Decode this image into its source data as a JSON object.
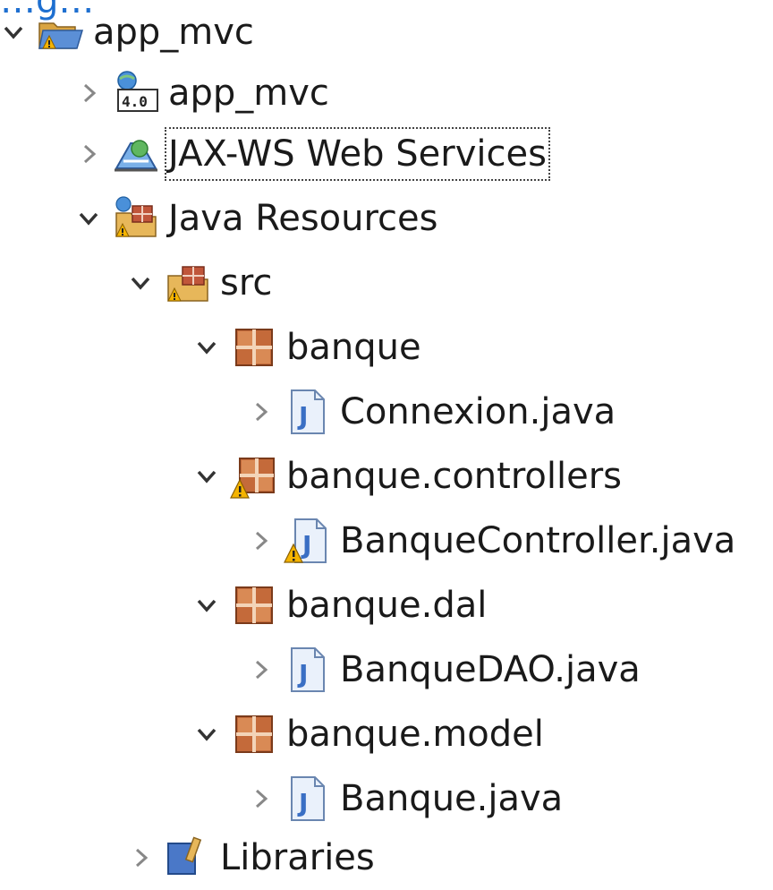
{
  "top_link": "…g…",
  "tree": {
    "items": [
      {
        "label": "app_mvc",
        "state": "expanded",
        "icon": "project-icon"
      },
      {
        "label": "app_mvc",
        "state": "collapsed",
        "icon": "deployment-descriptor-icon"
      },
      {
        "label": "JAX-WS Web Services",
        "state": "collapsed",
        "icon": "web-services-icon"
      },
      {
        "label": "Java Resources",
        "state": "expanded",
        "icon": "java-resources-icon"
      },
      {
        "label": "src",
        "state": "expanded",
        "icon": "source-folder-icon"
      },
      {
        "label": "banque",
        "state": "expanded",
        "icon": "package-icon"
      },
      {
        "label": "Connexion.java",
        "state": "collapsed",
        "icon": "java-file-icon"
      },
      {
        "label": "banque.controllers",
        "state": "expanded",
        "icon": "package-warning-icon"
      },
      {
        "label": "BanqueController.java",
        "state": "collapsed",
        "icon": "java-file-warning-icon"
      },
      {
        "label": "banque.dal",
        "state": "expanded",
        "icon": "package-icon"
      },
      {
        "label": "BanqueDAO.java",
        "state": "collapsed",
        "icon": "java-file-icon"
      },
      {
        "label": "banque.model",
        "state": "expanded",
        "icon": "package-icon"
      },
      {
        "label": "Banque.java",
        "state": "collapsed",
        "icon": "java-file-icon"
      },
      {
        "label": "Libraries",
        "state": "collapsed",
        "icon": "libraries-icon"
      }
    ]
  },
  "colors": {
    "accent": "#1e6fd0",
    "package": "#a0522d",
    "java_file": "#3a6fc4",
    "warning": "#f5b400"
  }
}
